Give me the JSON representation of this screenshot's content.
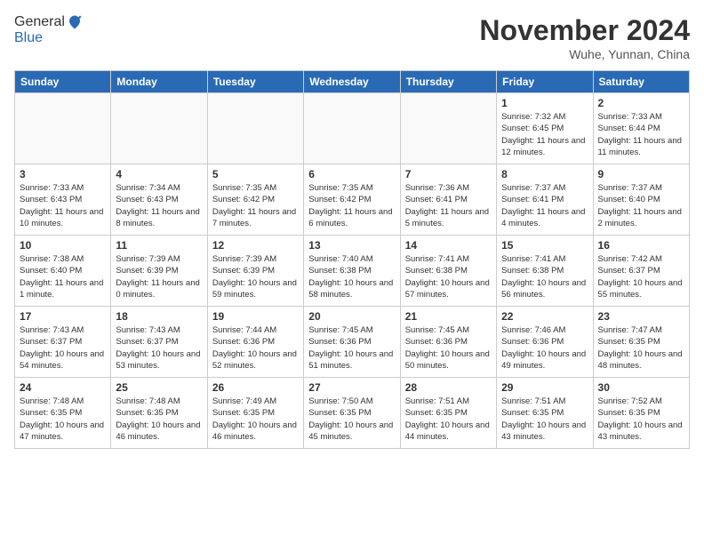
{
  "header": {
    "logo_line1": "General",
    "logo_line2": "Blue",
    "month_title": "November 2024",
    "location": "Wuhe, Yunnan, China"
  },
  "weekdays": [
    "Sunday",
    "Monday",
    "Tuesday",
    "Wednesday",
    "Thursday",
    "Friday",
    "Saturday"
  ],
  "weeks": [
    [
      {
        "day": "",
        "info": ""
      },
      {
        "day": "",
        "info": ""
      },
      {
        "day": "",
        "info": ""
      },
      {
        "day": "",
        "info": ""
      },
      {
        "day": "",
        "info": ""
      },
      {
        "day": "1",
        "info": "Sunrise: 7:32 AM\nSunset: 6:45 PM\nDaylight: 11 hours and 12 minutes."
      },
      {
        "day": "2",
        "info": "Sunrise: 7:33 AM\nSunset: 6:44 PM\nDaylight: 11 hours and 11 minutes."
      }
    ],
    [
      {
        "day": "3",
        "info": "Sunrise: 7:33 AM\nSunset: 6:43 PM\nDaylight: 11 hours and 10 minutes."
      },
      {
        "day": "4",
        "info": "Sunrise: 7:34 AM\nSunset: 6:43 PM\nDaylight: 11 hours and 8 minutes."
      },
      {
        "day": "5",
        "info": "Sunrise: 7:35 AM\nSunset: 6:42 PM\nDaylight: 11 hours and 7 minutes."
      },
      {
        "day": "6",
        "info": "Sunrise: 7:35 AM\nSunset: 6:42 PM\nDaylight: 11 hours and 6 minutes."
      },
      {
        "day": "7",
        "info": "Sunrise: 7:36 AM\nSunset: 6:41 PM\nDaylight: 11 hours and 5 minutes."
      },
      {
        "day": "8",
        "info": "Sunrise: 7:37 AM\nSunset: 6:41 PM\nDaylight: 11 hours and 4 minutes."
      },
      {
        "day": "9",
        "info": "Sunrise: 7:37 AM\nSunset: 6:40 PM\nDaylight: 11 hours and 2 minutes."
      }
    ],
    [
      {
        "day": "10",
        "info": "Sunrise: 7:38 AM\nSunset: 6:40 PM\nDaylight: 11 hours and 1 minute."
      },
      {
        "day": "11",
        "info": "Sunrise: 7:39 AM\nSunset: 6:39 PM\nDaylight: 11 hours and 0 minutes."
      },
      {
        "day": "12",
        "info": "Sunrise: 7:39 AM\nSunset: 6:39 PM\nDaylight: 10 hours and 59 minutes."
      },
      {
        "day": "13",
        "info": "Sunrise: 7:40 AM\nSunset: 6:38 PM\nDaylight: 10 hours and 58 minutes."
      },
      {
        "day": "14",
        "info": "Sunrise: 7:41 AM\nSunset: 6:38 PM\nDaylight: 10 hours and 57 minutes."
      },
      {
        "day": "15",
        "info": "Sunrise: 7:41 AM\nSunset: 6:38 PM\nDaylight: 10 hours and 56 minutes."
      },
      {
        "day": "16",
        "info": "Sunrise: 7:42 AM\nSunset: 6:37 PM\nDaylight: 10 hours and 55 minutes."
      }
    ],
    [
      {
        "day": "17",
        "info": "Sunrise: 7:43 AM\nSunset: 6:37 PM\nDaylight: 10 hours and 54 minutes."
      },
      {
        "day": "18",
        "info": "Sunrise: 7:43 AM\nSunset: 6:37 PM\nDaylight: 10 hours and 53 minutes."
      },
      {
        "day": "19",
        "info": "Sunrise: 7:44 AM\nSunset: 6:36 PM\nDaylight: 10 hours and 52 minutes."
      },
      {
        "day": "20",
        "info": "Sunrise: 7:45 AM\nSunset: 6:36 PM\nDaylight: 10 hours and 51 minutes."
      },
      {
        "day": "21",
        "info": "Sunrise: 7:45 AM\nSunset: 6:36 PM\nDaylight: 10 hours and 50 minutes."
      },
      {
        "day": "22",
        "info": "Sunrise: 7:46 AM\nSunset: 6:36 PM\nDaylight: 10 hours and 49 minutes."
      },
      {
        "day": "23",
        "info": "Sunrise: 7:47 AM\nSunset: 6:35 PM\nDaylight: 10 hours and 48 minutes."
      }
    ],
    [
      {
        "day": "24",
        "info": "Sunrise: 7:48 AM\nSunset: 6:35 PM\nDaylight: 10 hours and 47 minutes."
      },
      {
        "day": "25",
        "info": "Sunrise: 7:48 AM\nSunset: 6:35 PM\nDaylight: 10 hours and 46 minutes."
      },
      {
        "day": "26",
        "info": "Sunrise: 7:49 AM\nSunset: 6:35 PM\nDaylight: 10 hours and 46 minutes."
      },
      {
        "day": "27",
        "info": "Sunrise: 7:50 AM\nSunset: 6:35 PM\nDaylight: 10 hours and 45 minutes."
      },
      {
        "day": "28",
        "info": "Sunrise: 7:51 AM\nSunset: 6:35 PM\nDaylight: 10 hours and 44 minutes."
      },
      {
        "day": "29",
        "info": "Sunrise: 7:51 AM\nSunset: 6:35 PM\nDaylight: 10 hours and 43 minutes."
      },
      {
        "day": "30",
        "info": "Sunrise: 7:52 AM\nSunset: 6:35 PM\nDaylight: 10 hours and 43 minutes."
      }
    ]
  ]
}
